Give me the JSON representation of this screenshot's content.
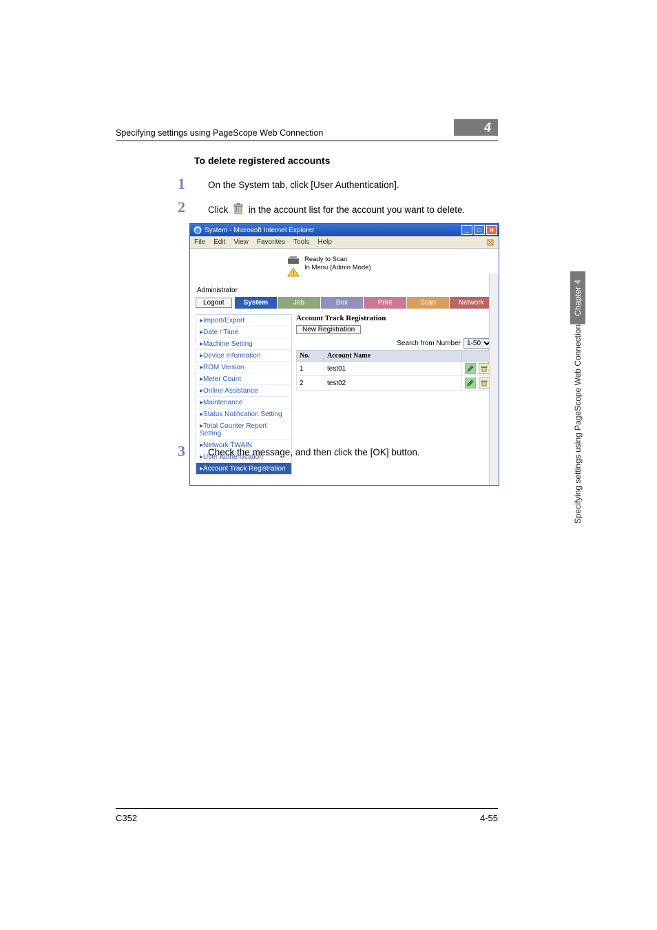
{
  "header": {
    "running_head": "Specifying settings using PageScope Web Connection",
    "chapter_number": "4"
  },
  "section": {
    "heading": "To delete registered accounts",
    "steps": {
      "1": "On the System tab, click [User Authentication].",
      "2_pre": "Click ",
      "2_post": " in the account list for the account you want to delete.",
      "3": "Check the message, and then click the [OK] button."
    }
  },
  "browser": {
    "title": "System - Microsoft Internet Explorer",
    "menu": [
      "File",
      "Edit",
      "View",
      "Favorites",
      "Tools",
      "Help"
    ],
    "status": {
      "line1": "Ready to Scan",
      "line2": "In Menu (Admin Mode)"
    },
    "role": "Administrator",
    "logout": "Logout",
    "tabs": {
      "system": "System",
      "job": "Job",
      "box": "Box",
      "print": "Print",
      "scan": "Scan",
      "network": "Network"
    },
    "sidebar": [
      "Import/Export",
      "Date / Time",
      "Machine Setting",
      "Device Information",
      "ROM Version",
      "Meter Count",
      "Online Assistance",
      "Maintenance",
      "Status Notification Setting",
      "Total Counter Report Setting",
      "Network TWAIN",
      "User Authentication",
      "Account Track Registration"
    ],
    "pane": {
      "title": "Account Track Registration",
      "new_reg": "New Registration",
      "search": "Search from Number",
      "range": "1-50",
      "cols": {
        "no": "No.",
        "account": "Account Name"
      },
      "rows": [
        {
          "no": "1",
          "name": "test01"
        },
        {
          "no": "2",
          "name": "test02"
        }
      ]
    }
  },
  "side": {
    "chapter": "Chapter 4",
    "caption": "Specifying settings using PageScope Web Connection"
  },
  "footer": {
    "model": "C352",
    "page": "4-55"
  }
}
